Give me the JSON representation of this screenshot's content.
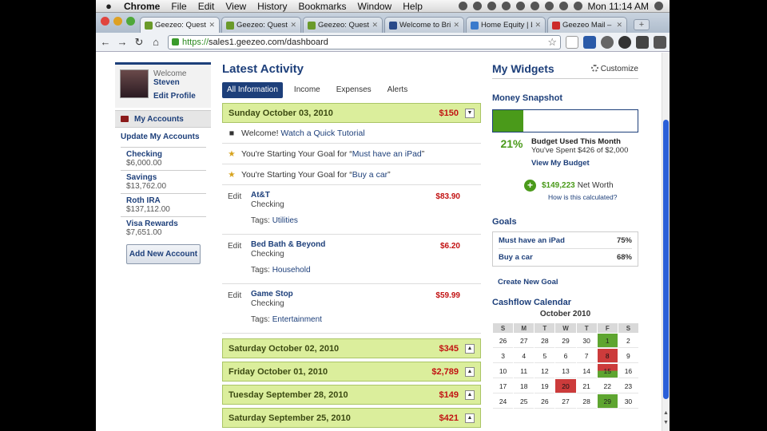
{
  "menubar": {
    "app": "Chrome",
    "items": [
      "File",
      "Edit",
      "View",
      "History",
      "Bookmarks",
      "Window",
      "Help"
    ],
    "clock": "Mon 11:14 AM"
  },
  "tabs": [
    {
      "label": "Geezeo: Questions",
      "active": true
    },
    {
      "label": "Geezeo: Questions",
      "active": false
    },
    {
      "label": "Geezeo: Questions",
      "active": false
    },
    {
      "label": "Welcome to Bridge",
      "active": false
    },
    {
      "label": "Home Equity | Loan",
      "active": false
    },
    {
      "label": "Geezeo Mail – [Ge",
      "active": false
    }
  ],
  "address": {
    "proto": "https://",
    "host": "sales1.geezeo.com/dashboard"
  },
  "profile": {
    "welcome": "Welcome",
    "name": "Steven",
    "edit": "Edit Profile"
  },
  "accounts": {
    "header": "My Accounts",
    "update": "Update My Accounts",
    "items": [
      {
        "name": "Checking",
        "balance": "$6,000.00"
      },
      {
        "name": "Savings",
        "balance": "$13,762.00"
      },
      {
        "name": "Roth IRA",
        "balance": "$137,112.00"
      },
      {
        "name": "Visa Rewards",
        "balance": "$7,651.00"
      }
    ],
    "add_button": "Add New Account"
  },
  "activity": {
    "title": "Latest Activity",
    "filters": [
      "All Information",
      "Income",
      "Expenses",
      "Alerts"
    ],
    "day1": {
      "date": "Sunday October 03, 2010",
      "amount": "$150"
    },
    "notices": [
      {
        "prefix": "Welcome! ",
        "link": "Watch a Quick Tutorial",
        "suffix": ""
      },
      {
        "prefix": "You're Starting Your Goal for “",
        "link": "Must have an iPad",
        "suffix": "”"
      },
      {
        "prefix": "You're Starting Your Goal for “",
        "link": "Buy a car",
        "suffix": "”"
      }
    ],
    "edit_label": "Edit",
    "tags_label": "Tags:",
    "transactions": [
      {
        "name": "At&T",
        "account": "Checking",
        "tag": "Utilities",
        "amount": "$83.90"
      },
      {
        "name": "Bed Bath & Beyond",
        "account": "Checking",
        "tag": "Household",
        "amount": "$6.20"
      },
      {
        "name": "Game Stop",
        "account": "Checking",
        "tag": "Entertainment",
        "amount": "$59.99"
      }
    ],
    "days": [
      {
        "date": "Saturday October 02, 2010",
        "amount": "$345"
      },
      {
        "date": "Friday October 01, 2010",
        "amount": "$2,789"
      },
      {
        "date": "Tuesday September 28, 2010",
        "amount": "$149"
      },
      {
        "date": "Saturday September 25, 2010",
        "amount": "$421"
      }
    ]
  },
  "widgets": {
    "title": "My Widgets",
    "customize": "Customize",
    "snapshot": {
      "title": "Money Snapshot",
      "used_fraction": 0.21,
      "percent": "21%",
      "budget_title": "Budget Used This Month",
      "budget_sub": "You've Spent $426 of $2,000",
      "view": "View My Budget",
      "net_worth_value": "$149,223",
      "net_worth_label": "Net Worth",
      "calc": "How is this calculated?"
    },
    "goals": {
      "title": "Goals",
      "items": [
        {
          "name": "Must have an iPad",
          "pct": "75%"
        },
        {
          "name": "Buy a car",
          "pct": "68%"
        }
      ],
      "create": "Create New Goal"
    },
    "calendar": {
      "title": "Cashflow Calendar",
      "month": "October 2010",
      "days": [
        "S",
        "M",
        "T",
        "W",
        "T",
        "F",
        "S"
      ],
      "weeks": [
        [
          "26",
          "27",
          "28",
          "29",
          "30",
          "1",
          "2"
        ],
        [
          "3",
          "4",
          "5",
          "6",
          "7",
          "8",
          "9"
        ],
        [
          "10",
          "11",
          "12",
          "13",
          "14",
          "15",
          "16"
        ],
        [
          "17",
          "18",
          "19",
          "20",
          "21",
          "22",
          "23"
        ],
        [
          "24",
          "25",
          "26",
          "27",
          "28",
          "29",
          "30"
        ]
      ],
      "colors": {
        "green": "#5ea530",
        "red": "#cc3b3b"
      }
    }
  }
}
